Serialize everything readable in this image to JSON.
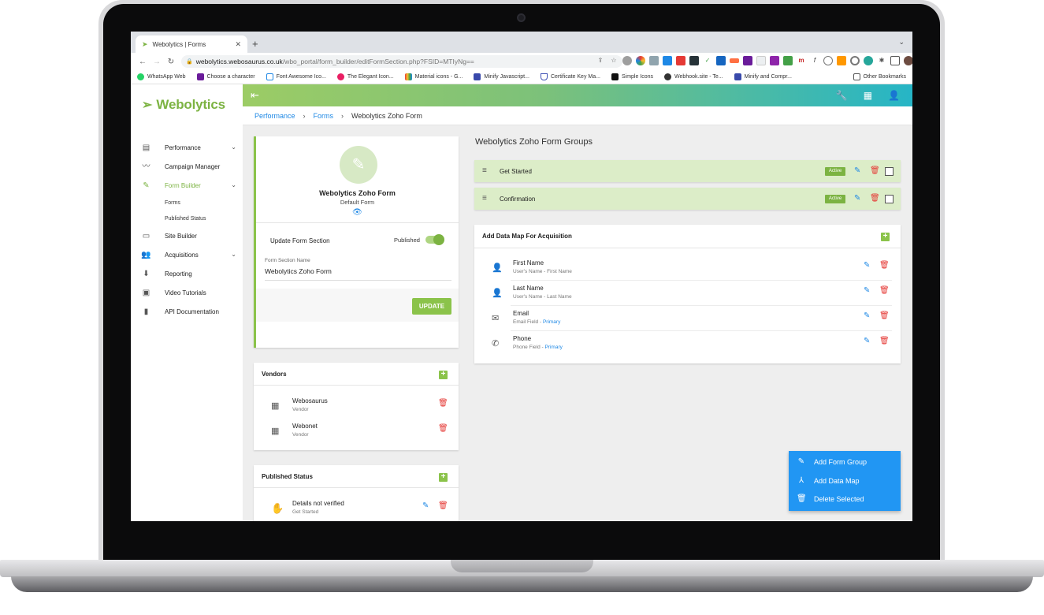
{
  "browser": {
    "tab_title": "Webolytics | Forms",
    "url_domain": "webolytics.webosaurus.co.uk",
    "url_path": "/wbo_portal/form_builder/editFormSection.php?FSID=MTIyNg==",
    "bookmarks": [
      "WhatsApp Web",
      "Choose a character",
      "Font Awesome Ico...",
      "The Elegant Icon...",
      "Material icons - G...",
      "Minify Javascript...",
      "Certificate Key Ma...",
      "Simple Icons",
      "Webhook.site - Te...",
      "Minify and Compr..."
    ],
    "other_bookmarks": "Other Bookmarks"
  },
  "app": {
    "logo": "Webolytics",
    "nav": {
      "performance": "Performance",
      "campaign_manager": "Campaign Manager",
      "form_builder": "Form Builder",
      "forms": "Forms",
      "published_status": "Published Status",
      "site_builder": "Site Builder",
      "acquisitions": "Acquisitions",
      "reporting": "Reporting",
      "video_tutorials": "Video Tutorials",
      "api_documentation": "API Documentation"
    },
    "breadcrumb": {
      "item1": "Performance",
      "item2": "Forms",
      "current": "Webolytics Zoho Form"
    }
  },
  "form_card": {
    "name": "Webolytics Zoho Form",
    "subtitle": "Default Form",
    "section_label": "Update Form Section",
    "published_label": "Published",
    "field_label": "Form Section Name",
    "field_value": "Webolytics Zoho Form",
    "update_button": "UPDATE"
  },
  "vendors": {
    "title": "Vendors",
    "items": [
      {
        "name": "Webosaurus",
        "type": "Vendor"
      },
      {
        "name": "Webonet",
        "type": "Vendor"
      }
    ]
  },
  "published_status": {
    "title": "Published Status",
    "item_title": "Details not verified",
    "item_sub": "Get Started"
  },
  "groups": {
    "title": "Webolytics Zoho Form Groups",
    "items": [
      {
        "name": "Get Started",
        "badge": "Active"
      },
      {
        "name": "Confirmation",
        "badge": "Active"
      }
    ]
  },
  "datamap": {
    "title": "Add Data Map For Acquisition",
    "items": [
      {
        "title": "First Name",
        "sub": "User's Name - First Name",
        "primary": ""
      },
      {
        "title": "Last Name",
        "sub": "User's Name - Last Name",
        "primary": ""
      },
      {
        "title": "Email",
        "sub": "Email Field - ",
        "primary": "Primary"
      },
      {
        "title": "Phone",
        "sub": "Phone Field - ",
        "primary": "Primary"
      }
    ]
  },
  "fab_menu": {
    "add_form_group": "Add Form Group",
    "add_data_map": "Add Data Map",
    "delete_selected": "Delete Selected"
  },
  "colors": {
    "brand_green": "#7cb342",
    "accent_blue": "#1e88e5",
    "danger_red": "#e53935",
    "fab_blue": "#2196f3"
  }
}
